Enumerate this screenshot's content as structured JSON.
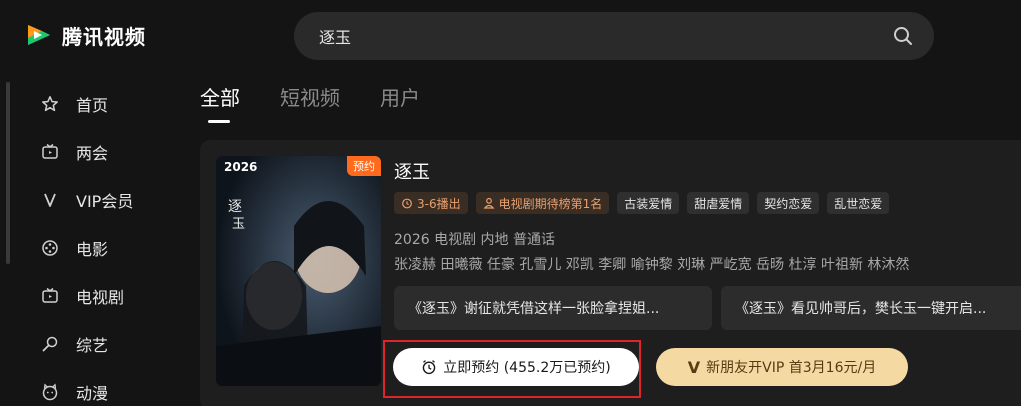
{
  "brand": {
    "name": "腾讯视频"
  },
  "search": {
    "value": "逐玉"
  },
  "sidebar": {
    "items": [
      {
        "label": "首页",
        "icon": "star-icon"
      },
      {
        "label": "两会",
        "icon": "tv-icon"
      },
      {
        "label": "VIP会员",
        "icon": "vip-v-icon"
      },
      {
        "label": "电影",
        "icon": "film-reel-icon"
      },
      {
        "label": "电视剧",
        "icon": "tv-icon"
      },
      {
        "label": "综艺",
        "icon": "microphone-icon"
      },
      {
        "label": "动漫",
        "icon": "cartoon-face-icon"
      }
    ]
  },
  "tabs": [
    {
      "label": "全部",
      "active": true
    },
    {
      "label": "短视频",
      "active": false
    },
    {
      "label": "用户",
      "active": false
    }
  ],
  "result": {
    "poster": {
      "year": "2026",
      "badge": "预约"
    },
    "title": "逐玉",
    "tags": [
      {
        "label": "3-6播出",
        "icon": "alarm-clock-icon",
        "style": "warm"
      },
      {
        "label": "电视剧期待榜第1名",
        "icon": "person-icon",
        "style": "warm"
      },
      {
        "label": "古装爱情"
      },
      {
        "label": "甜虐爱情"
      },
      {
        "label": "契约恋爱"
      },
      {
        "label": "乱世恋爱"
      }
    ],
    "meta": "2026 电视剧 内地 普通话",
    "cast": "张凌赫 田曦薇 任豪 孔雪儿 邓凯 李卿 喻钟黎 刘琳 严屹宽 岳旸 杜淳 叶祖新 林沐然",
    "clips": [
      "《逐玉》谢征就凭借这样一张脸拿捏姐...",
      "《逐玉》看见帅哥后，樊长玉一键开启..."
    ],
    "reserve_button": "立即预约 (455.2万已预约)",
    "vip_button": "新朋友开VIP 首3月16元/月",
    "vip_mark": "V"
  },
  "colors": {
    "background": "#141414",
    "card": "#1e1e1e",
    "badge": "#ff6a1c",
    "highlight": "#e0242b",
    "vip_button": "#f5d9a3"
  }
}
